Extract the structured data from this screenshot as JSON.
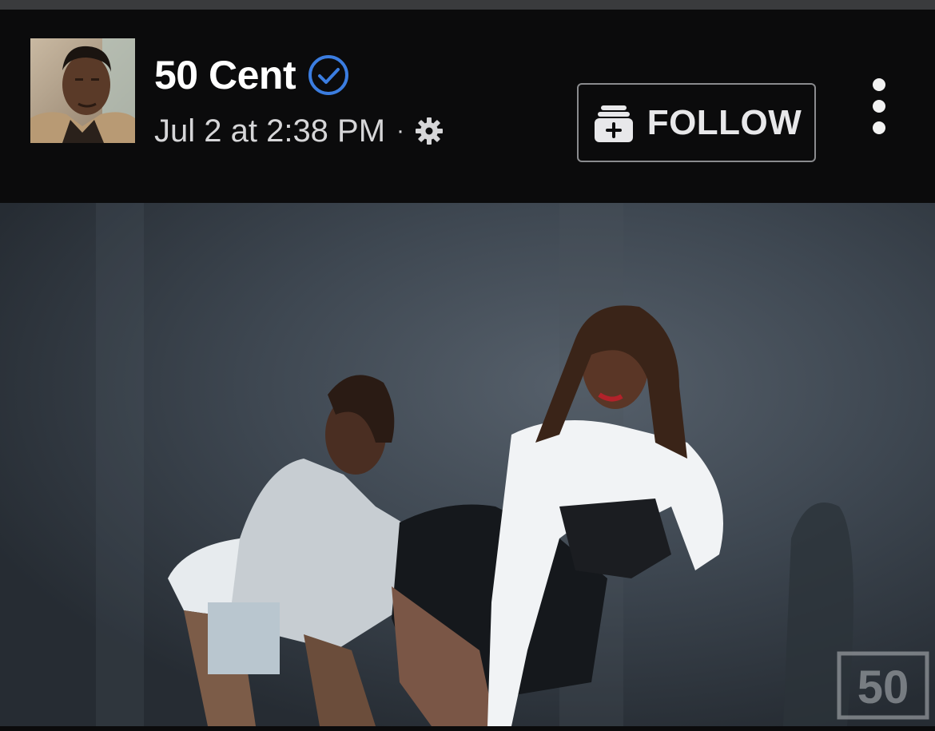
{
  "post": {
    "author": "50 Cent",
    "timestamp": "Jul 2 at 2:38 PM",
    "separator": "·",
    "verified": true,
    "audience_icon": "gear-icon"
  },
  "actions": {
    "follow_label": "FOLLOW",
    "follow_icon": "add-to-feed-icon",
    "more_icon": "more-vertical-icon"
  },
  "media": {
    "type": "video-frame",
    "watermark": "50"
  },
  "colors": {
    "background": "#0b0b0c",
    "verified_blue": "#3b7de0",
    "text_primary": "#ffffff",
    "text_secondary": "#d6d6d8",
    "button_border": "#8a8b8e"
  }
}
